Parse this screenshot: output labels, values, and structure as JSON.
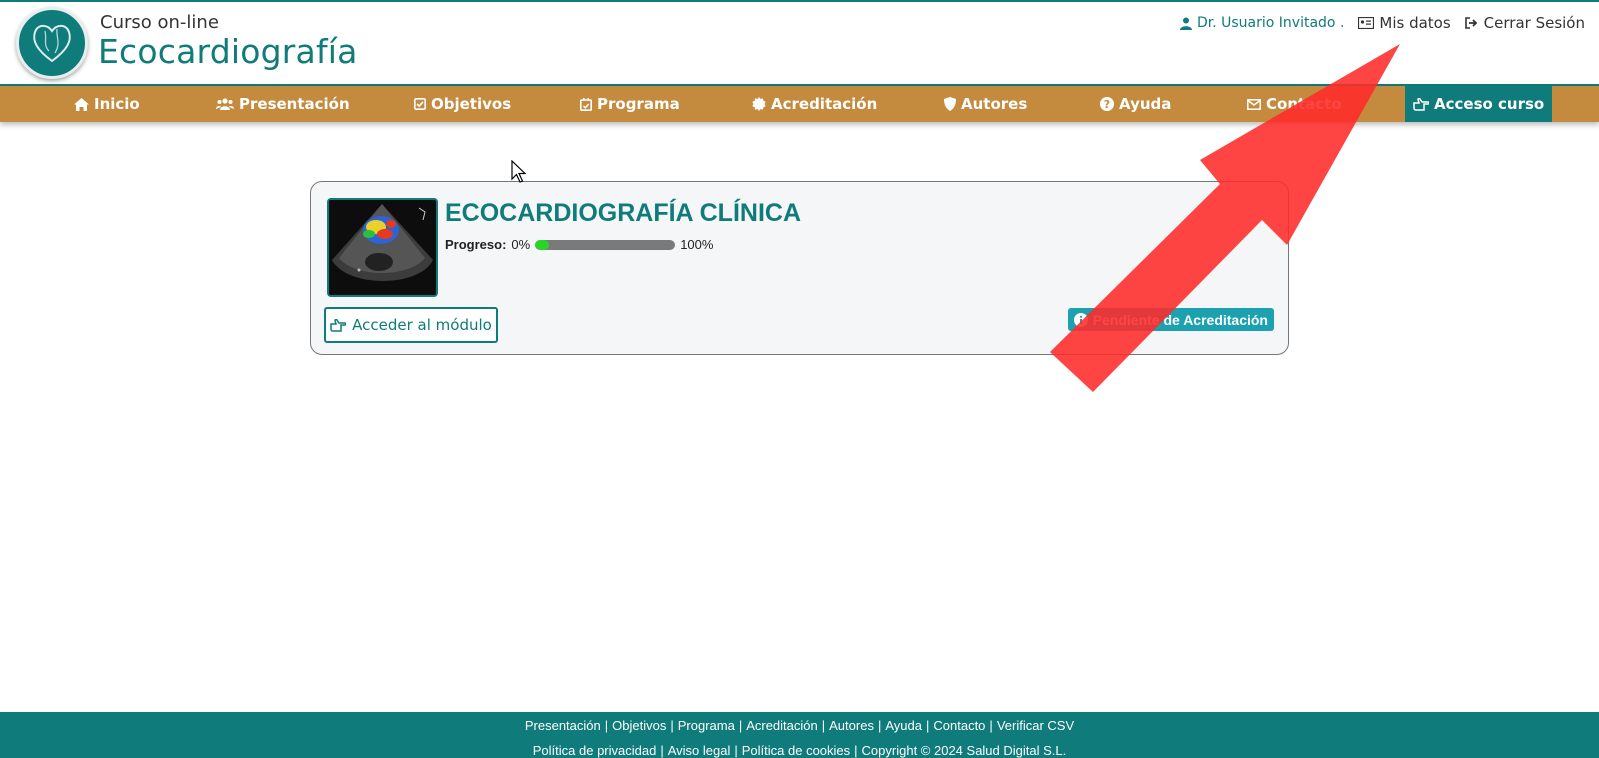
{
  "header": {
    "brand_top": "Curso  on-line",
    "brand_main": "Ecocardiografía",
    "user_name": "Dr. Usuario Invitado .",
    "my_data": "Mis datos",
    "logout": "Cerrar Sesión"
  },
  "nav": {
    "items": [
      {
        "label": "Inicio",
        "icon": "home-icon"
      },
      {
        "label": "Presentación",
        "icon": "users-icon"
      },
      {
        "label": "Objetivos",
        "icon": "check-square-icon"
      },
      {
        "label": "Programa",
        "icon": "calendar-check-icon"
      },
      {
        "label": "Acreditación",
        "icon": "certificate-icon"
      },
      {
        "label": "Autores",
        "icon": "shield-icon"
      },
      {
        "label": "Ayuda",
        "icon": "question-circle-icon"
      },
      {
        "label": "Contacto",
        "icon": "envelope-icon"
      },
      {
        "label": "Acceso curso",
        "icon": "hand-point-right-icon"
      }
    ],
    "active_index": 8
  },
  "module": {
    "title": "ECOCARDIOGRAFÍA CLÍNICA",
    "progress_label": "Progreso:",
    "progress_min": "0%",
    "progress_max": "100%",
    "progress_value": 0.1,
    "access_button": "Acceder al módulo",
    "status_badge": "Pendiente de Acreditación"
  },
  "footer": {
    "line1": [
      "Presentación",
      "Objetivos",
      "Programa",
      "Acreditación",
      "Autores",
      "Ayuda",
      "Contacto",
      "Verificar CSV"
    ],
    "line2": [
      "Política de privacidad",
      "Aviso legal",
      "Política de cookies",
      "Copyright © 2024 Salud Digital S.L."
    ]
  },
  "colors": {
    "brand_teal": "#0f7b7b",
    "nav_bg": "#c48b3f",
    "badge_bg": "#1ba1b0",
    "progress_fill": "#2ad32a",
    "annotation_arrow": "#ff2a2a"
  }
}
